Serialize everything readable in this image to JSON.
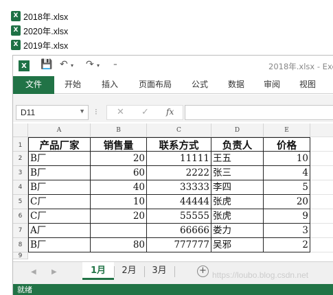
{
  "desktop_files": [
    {
      "name": "2018年.xlsx",
      "icon": "excel-file-icon"
    },
    {
      "name": "2020年.xlsx",
      "icon": "excel-file-icon"
    },
    {
      "name": "2019年.xlsx",
      "icon": "excel-file-icon"
    }
  ],
  "window": {
    "title": "2018年.xlsx - Exc",
    "app_icon": "X"
  },
  "quick_access": {
    "save": "💾",
    "undo": "↶",
    "redo": "↷",
    "customize": "⁼"
  },
  "ribbon_tabs": [
    "文件",
    "开始",
    "插入",
    "页面布局",
    "公式",
    "数据",
    "审阅",
    "视图"
  ],
  "formula_bar": {
    "name_box": "D11",
    "name_box_arrow": "▼",
    "dots": "⁝",
    "cancel": "✕",
    "enter": "✓",
    "fx": "fx",
    "formula": ""
  },
  "columns": [
    "A",
    "B",
    "C",
    "D",
    "E"
  ],
  "row_numbers": [
    "1",
    "2",
    "3",
    "4",
    "5",
    "6",
    "7",
    "8",
    "9"
  ],
  "table": {
    "headers": [
      "产品厂家",
      "销售量",
      "联系方式",
      "负责人",
      "价格"
    ],
    "rows": [
      [
        "B厂",
        "20",
        "11111",
        "王五",
        "10"
      ],
      [
        "B厂",
        "60",
        "2222",
        "张三",
        "4"
      ],
      [
        "B厂",
        "40",
        "33333",
        "李四",
        "5"
      ],
      [
        "C厂",
        "10",
        "44444",
        "张虎",
        "20"
      ],
      [
        "C厂",
        "20",
        "55555",
        "张虎",
        "9"
      ],
      [
        "A厂",
        "",
        "66666",
        "娄力",
        "3"
      ],
      [
        "B厂",
        "80",
        "777777",
        "吴邪",
        "2"
      ]
    ]
  },
  "sheet_nav": {
    "prev": "◀",
    "next": "▶"
  },
  "sheet_tabs": [
    "1月",
    "2月",
    "3月"
  ],
  "active_sheet": "1月",
  "add_sheet": "+",
  "watermark": "https://loubo.blog.csdn.net",
  "status_text": "就绪",
  "colors": {
    "excel_green": "#217346",
    "active_tab_text": "#217346"
  }
}
